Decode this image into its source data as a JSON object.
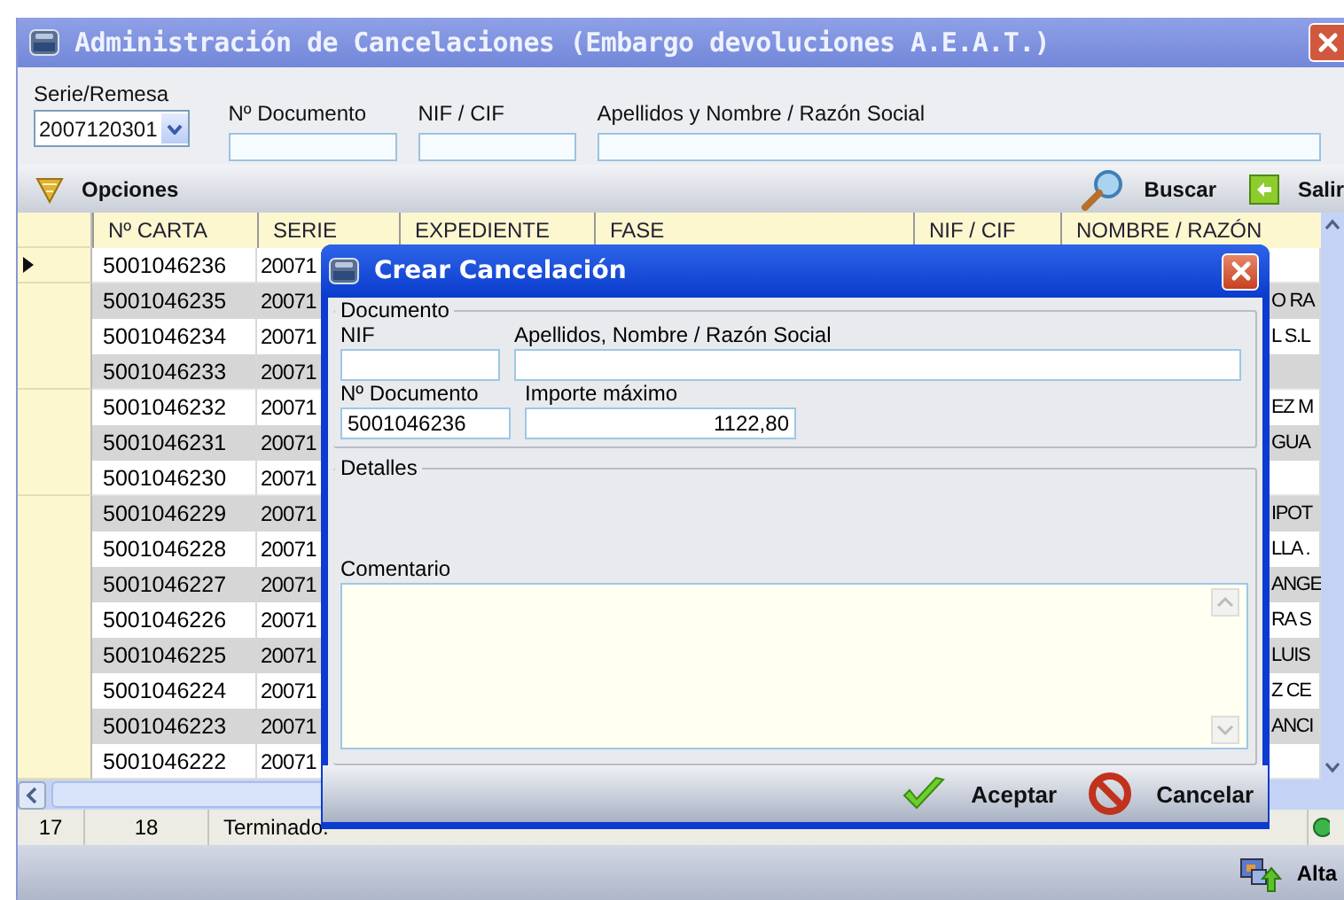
{
  "window": {
    "title": "Administración de Cancelaciones (Embargo devoluciones A.E.A.T.)"
  },
  "filters": [
    {
      "kind": "select",
      "label": "Serie/Remesa",
      "value": "2007120301"
    },
    {
      "kind": "text",
      "label": "Nº Documento"
    },
    {
      "kind": "text",
      "label": "NIF / CIF"
    },
    {
      "kind": "text",
      "label": "Apellidos y Nombre / Razón Social"
    }
  ],
  "toolbar": {
    "menu": "Opciones",
    "buttons": [
      {
        "kind": "search",
        "label": "Buscar"
      },
      {
        "kind": "exit",
        "label": "Salir"
      }
    ]
  },
  "table": {
    "columns": [
      "Nº CARTA",
      "SERIE",
      "EXPEDIENTE",
      "FASE",
      "NIF / CIF",
      "NOMBRE / RAZÓN"
    ],
    "rows": [
      {
        "selected": true,
        "n_carta": "5001046236",
        "serie": "20071",
        "nombre": ""
      },
      {
        "selected": false,
        "n_carta": "5001046235",
        "serie": "20071",
        "nombre": "O RA"
      },
      {
        "selected": false,
        "n_carta": "5001046234",
        "serie": "20071",
        "nombre": "L S.L"
      },
      {
        "selected": false,
        "n_carta": "5001046233",
        "serie": "20071",
        "nombre": ""
      },
      {
        "selected": false,
        "n_carta": "5001046232",
        "serie": "20071",
        "nombre": "EZ M"
      },
      {
        "selected": false,
        "n_carta": "5001046231",
        "serie": "20071",
        "nombre": "GUA"
      },
      {
        "selected": false,
        "n_carta": "5001046230",
        "serie": "20071",
        "nombre": ""
      },
      {
        "selected": false,
        "n_carta": "5001046229",
        "serie": "20071",
        "nombre": "IPOT"
      },
      {
        "selected": false,
        "n_carta": "5001046228",
        "serie": "20071",
        "nombre": "LLA ."
      },
      {
        "selected": false,
        "n_carta": "5001046227",
        "serie": "20071",
        "nombre": "ANGE"
      },
      {
        "selected": false,
        "n_carta": "5001046226",
        "serie": "20071",
        "nombre": "RA S"
      },
      {
        "selected": false,
        "n_carta": "5001046225",
        "serie": "20071",
        "nombre": "LUIS"
      },
      {
        "selected": false,
        "n_carta": "5001046224",
        "serie": "20071",
        "nombre": "Z CE"
      },
      {
        "selected": false,
        "n_carta": "5001046223",
        "serie": "20071",
        "nombre": "ANCI"
      },
      {
        "selected": false,
        "n_carta": "5001046222",
        "serie": "20071",
        "nombre": ""
      }
    ]
  },
  "status_bar": [
    "17",
    "18",
    "Terminado."
  ],
  "bottom_bar": {
    "button": "Alta"
  },
  "dialog": {
    "title": "Crear Cancelación",
    "groups": [
      {
        "legend": "Documento",
        "fields": [
          {
            "kind": "text",
            "label": "NIF"
          },
          {
            "kind": "text",
            "label": "Apellidos, Nombre / Razón Social"
          },
          {
            "kind": "text",
            "label": "Nº Documento",
            "value": "5001046236"
          },
          {
            "kind": "amount",
            "label": "Importe máximo",
            "value": "1122,80"
          }
        ]
      },
      {
        "legend": "Detalles",
        "comment_label": "Comentario"
      }
    ],
    "buttons": [
      {
        "kind": "ok",
        "label": "Aceptar"
      },
      {
        "kind": "cancel",
        "label": "Cancelar"
      }
    ]
  }
}
